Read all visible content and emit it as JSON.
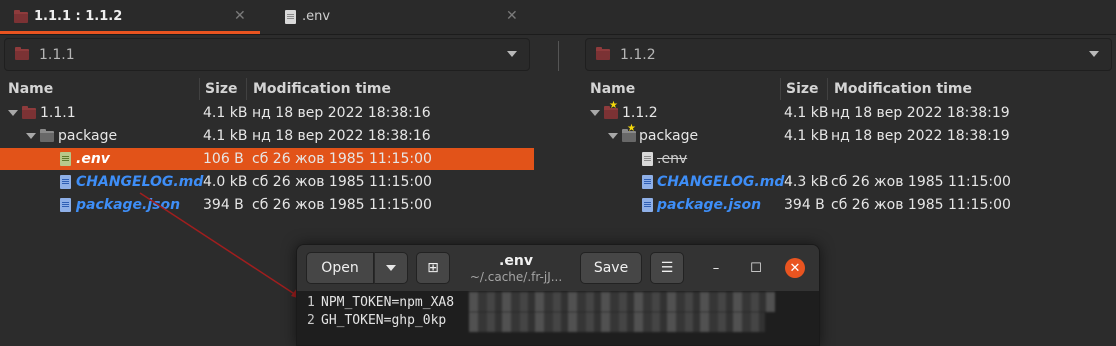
{
  "tabs": [
    {
      "label": "1.1.1 : 1.1.2",
      "icon": "folder-icon",
      "active": true
    },
    {
      "label": ".env",
      "icon": "file-icon",
      "active": false
    }
  ],
  "tab_close": "✕",
  "left": {
    "path": "1.1.1",
    "columns": {
      "name": "Name",
      "size": "Size",
      "modified": "Modification time"
    },
    "rows": [
      {
        "name": "1.1.1",
        "size": "4.1 kB",
        "modified": "нд 18 вер 2022 18:38:16"
      },
      {
        "name": "package",
        "size": "4.1 kB",
        "modified": "нд 18 вер 2022 18:38:16"
      },
      {
        "name": ".env",
        "size": "106 B",
        "modified": "сб 26 жов 1985 11:15:00"
      },
      {
        "name": "CHANGELOG.md",
        "size": "4.0 kB",
        "modified": "сб 26 жов 1985 11:15:00"
      },
      {
        "name": "package.json",
        "size": "394 B",
        "modified": "сб 26 жов 1985 11:15:00"
      }
    ]
  },
  "right": {
    "path": "1.1.2",
    "columns": {
      "name": "Name",
      "size": "Size",
      "modified": "Modification time"
    },
    "rows": [
      {
        "name": "1.1.2",
        "size": "4.1 kB",
        "modified": "нд 18 вер 2022 18:38:19"
      },
      {
        "name": "package",
        "size": "4.1 kB",
        "modified": "нд 18 вер 2022 18:38:19"
      },
      {
        "name": ".env",
        "size": "",
        "modified": ""
      },
      {
        "name": "CHANGELOG.md",
        "size": "4.3 kB",
        "modified": "сб 26 жов 1985 11:15:00"
      },
      {
        "name": "package.json",
        "size": "394 B",
        "modified": "сб 26 жов 1985 11:15:00"
      }
    ]
  },
  "editor": {
    "open_label": "Open",
    "save_label": "Save",
    "title": ".env",
    "subtitle": "~/.cache/.fr-jJ...",
    "menu_glyph": "☰",
    "minimize_glyph": "–",
    "maximize_glyph": "☐",
    "close_glyph": "✕",
    "new_tab_glyph": "⊞",
    "lines": [
      {
        "num": "1",
        "text": "NPM_TOKEN=npm_XA8"
      },
      {
        "num": "2",
        "text": "GH_TOKEN=ghp_0kp"
      }
    ]
  },
  "colors": {
    "accent": "#e95420",
    "selection": "#e25319",
    "link_blue": "#3e8ef7",
    "arrow": "#a01e1e"
  }
}
